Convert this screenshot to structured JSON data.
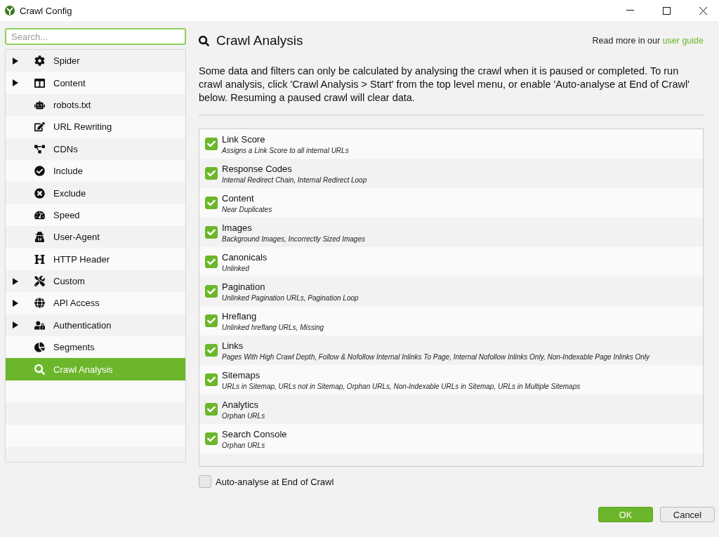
{
  "window": {
    "title": "Crawl Config"
  },
  "sidebar": {
    "search": {
      "placeholder": "Search..."
    },
    "items": [
      {
        "label": "Spider",
        "expandable": true,
        "selected": false
      },
      {
        "label": "Content",
        "expandable": true,
        "selected": false
      },
      {
        "label": "robots.txt",
        "expandable": false,
        "selected": false
      },
      {
        "label": "URL Rewriting",
        "expandable": false,
        "selected": false
      },
      {
        "label": "CDNs",
        "expandable": false,
        "selected": false
      },
      {
        "label": "Include",
        "expandable": false,
        "selected": false
      },
      {
        "label": "Exclude",
        "expandable": false,
        "selected": false
      },
      {
        "label": "Speed",
        "expandable": false,
        "selected": false
      },
      {
        "label": "User-Agent",
        "expandable": false,
        "selected": false
      },
      {
        "label": "HTTP Header",
        "expandable": false,
        "selected": false
      },
      {
        "label": "Custom",
        "expandable": true,
        "selected": false
      },
      {
        "label": "API Access",
        "expandable": true,
        "selected": false
      },
      {
        "label": "Authentication",
        "expandable": true,
        "selected": false
      },
      {
        "label": "Segments",
        "expandable": false,
        "selected": false
      },
      {
        "label": "Crawl Analysis",
        "expandable": false,
        "selected": true
      }
    ]
  },
  "panel": {
    "title": "Crawl Analysis",
    "guide_text": "Read more in our",
    "guide_link": "user guide",
    "description": "Some data and filters can only be calculated by analysing the crawl when it is paused or completed. To run crawl analysis, click 'Crawl Analysis > Start' from the top level menu, or enable 'Auto-analyse at End of Crawl' below. Resuming a paused crawl will clear data.",
    "options": [
      {
        "label": "Link Score",
        "detail": "Assigns a Link Score to all internal URLs",
        "checked": true
      },
      {
        "label": "Response Codes",
        "detail": "Internal Redirect Chain, Internal Redirect Loop",
        "checked": true
      },
      {
        "label": "Content",
        "detail": "Near Duplicates",
        "checked": true
      },
      {
        "label": "Images",
        "detail": "Background Images, Incorrectly Sized Images",
        "checked": true
      },
      {
        "label": "Canonicals",
        "detail": "Unlinked",
        "checked": true
      },
      {
        "label": "Pagination",
        "detail": "Unlinked Pagination URLs, Pagination Loop",
        "checked": true
      },
      {
        "label": "Hreflang",
        "detail": "Unlinked hreflang URLs, Missing",
        "checked": true
      },
      {
        "label": "Links",
        "detail": "Pages With High Crawl Depth, Follow & Nofollow Internal Inlinks To Page, Internal Nofollow Inlinks Only, Non-Indexable Page Inlinks Only",
        "checked": true
      },
      {
        "label": "Sitemaps",
        "detail": "URLs in Sitemap, URLs not in Sitemap, Orphan URLs, Non-Indexable URLs in Sitemap, URLs in Multiple Sitemaps",
        "checked": true
      },
      {
        "label": "Analytics",
        "detail": "Orphan URLs",
        "checked": true
      },
      {
        "label": "Search Console",
        "detail": "Orphan URLs",
        "checked": true
      }
    ],
    "auto_analyse": {
      "label": "Auto-analyse at End of Crawl",
      "checked": false
    }
  },
  "buttons": [
    {
      "label": "OK",
      "kind": "primary"
    },
    {
      "label": "Cancel",
      "kind": "secondary"
    }
  ]
}
